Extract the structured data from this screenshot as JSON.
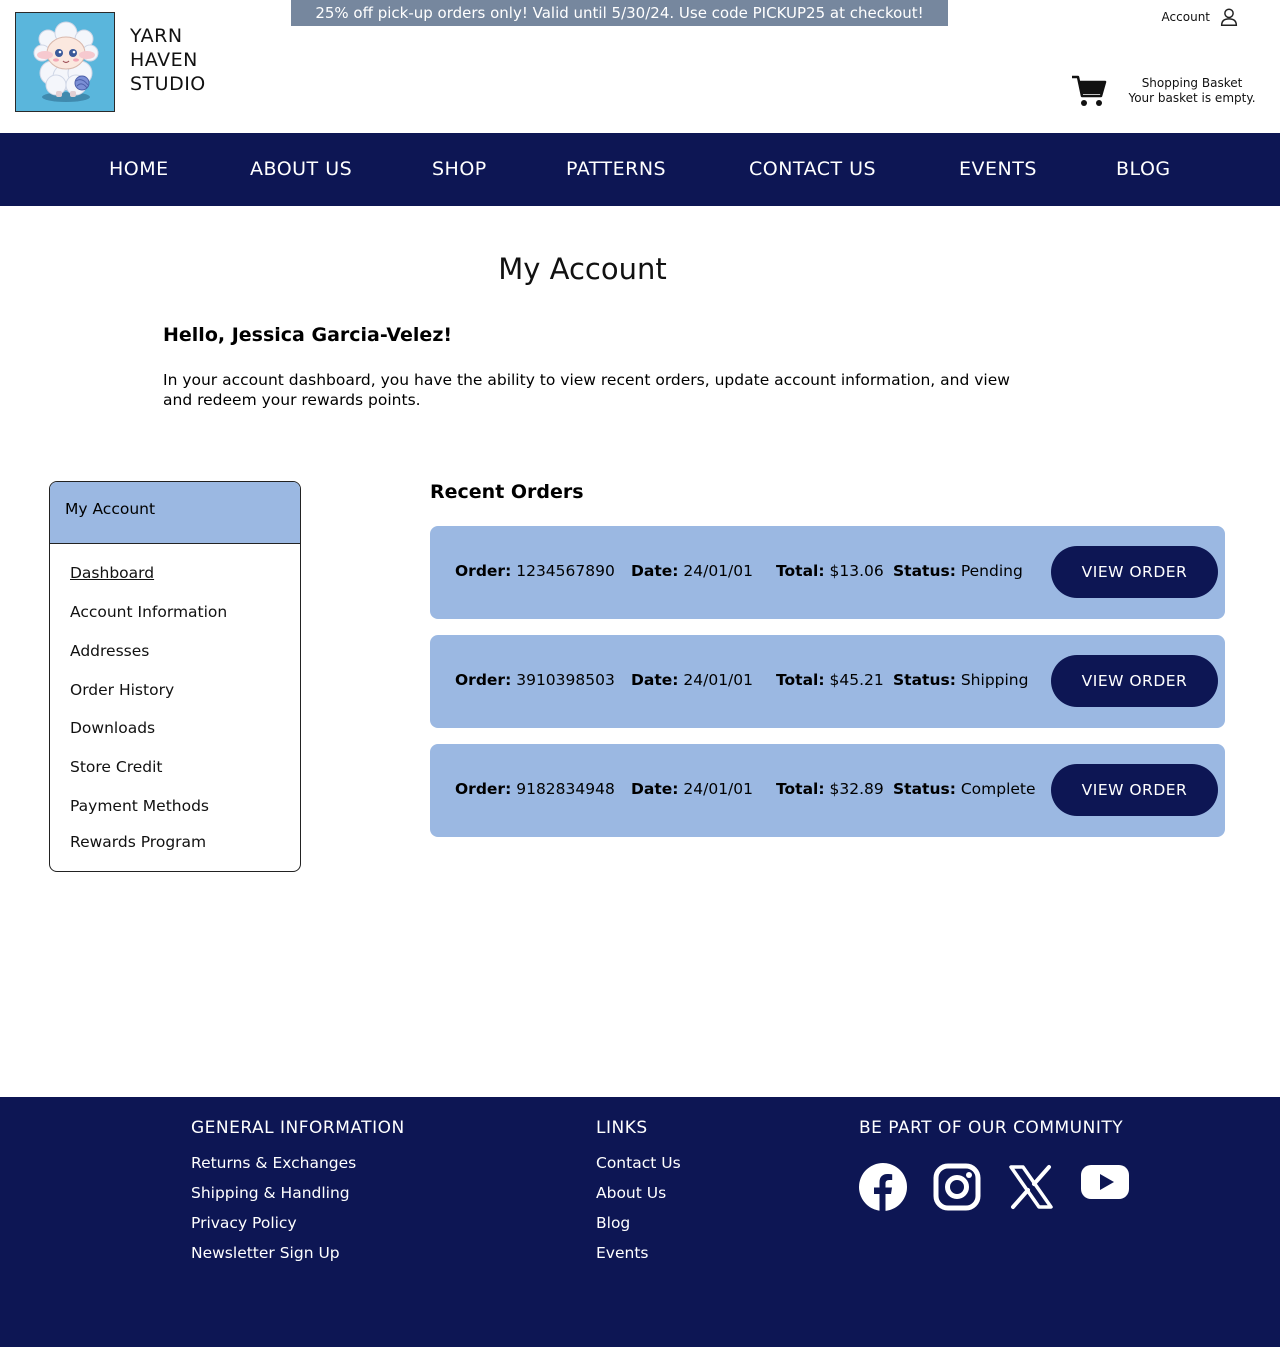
{
  "promo_banner": "25% off pick-up orders only! Valid until 5/30/24. Use code PICKUP25 at checkout!",
  "brand": {
    "line1": "YARN",
    "line2": "HAVEN",
    "line3": "STUDIO",
    "logo_icon": "sheep-mascot"
  },
  "header": {
    "account_label": "Account",
    "basket_title": "Shopping Basket",
    "basket_status": "Your basket is empty."
  },
  "nav": [
    "HOME",
    "ABOUT US",
    "SHOP",
    "PATTERNS",
    "CONTACT US",
    "EVENTS",
    "BLOG"
  ],
  "page": {
    "title": "My Account",
    "greeting": "Hello, Jessica Garcia-Velez!",
    "intro": "In your account dashboard, you have the ability to view recent orders, update account information, and view and redeem your rewards points."
  },
  "sidebar": {
    "title": "My Account",
    "items": [
      "Dashboard",
      "Account Information",
      "Addresses",
      "Order History",
      "Downloads",
      "Store Credit",
      "Payment Methods",
      "Rewards Program"
    ],
    "active": "Dashboard"
  },
  "recent_orders": {
    "title": "Recent Orders",
    "labels": {
      "order": "Order:",
      "date": "Date:",
      "total": "Total:",
      "status": "Status:"
    },
    "button_label": "VIEW ORDER",
    "orders": [
      {
        "number": "1234567890",
        "date": "24/01/01",
        "total": "$13.06",
        "status": "Pending"
      },
      {
        "number": "3910398503",
        "date": "24/01/01",
        "total": "$45.21",
        "status": "Shipping"
      },
      {
        "number": "9182834948",
        "date": "24/01/01",
        "total": "$32.89",
        "status": "Complete"
      }
    ]
  },
  "footer": {
    "general": {
      "title": "GENERAL INFORMATION",
      "links": [
        "Returns & Exchanges",
        "Shipping & Handling",
        "Privacy Policy",
        "Newsletter Sign Up"
      ]
    },
    "links": {
      "title": "LINKS",
      "links": [
        "Contact Us",
        "About Us",
        "Blog",
        "Events"
      ]
    },
    "community": {
      "title": "BE PART OF OUR COMMUNITY",
      "icons": [
        "facebook-icon",
        "instagram-icon",
        "x-icon",
        "youtube-icon"
      ]
    }
  },
  "colors": {
    "navy": "#0d1654",
    "light_blue": "#9bb8e2",
    "promo_gray": "#76879e",
    "logo_blue": "#5ab6dc"
  }
}
